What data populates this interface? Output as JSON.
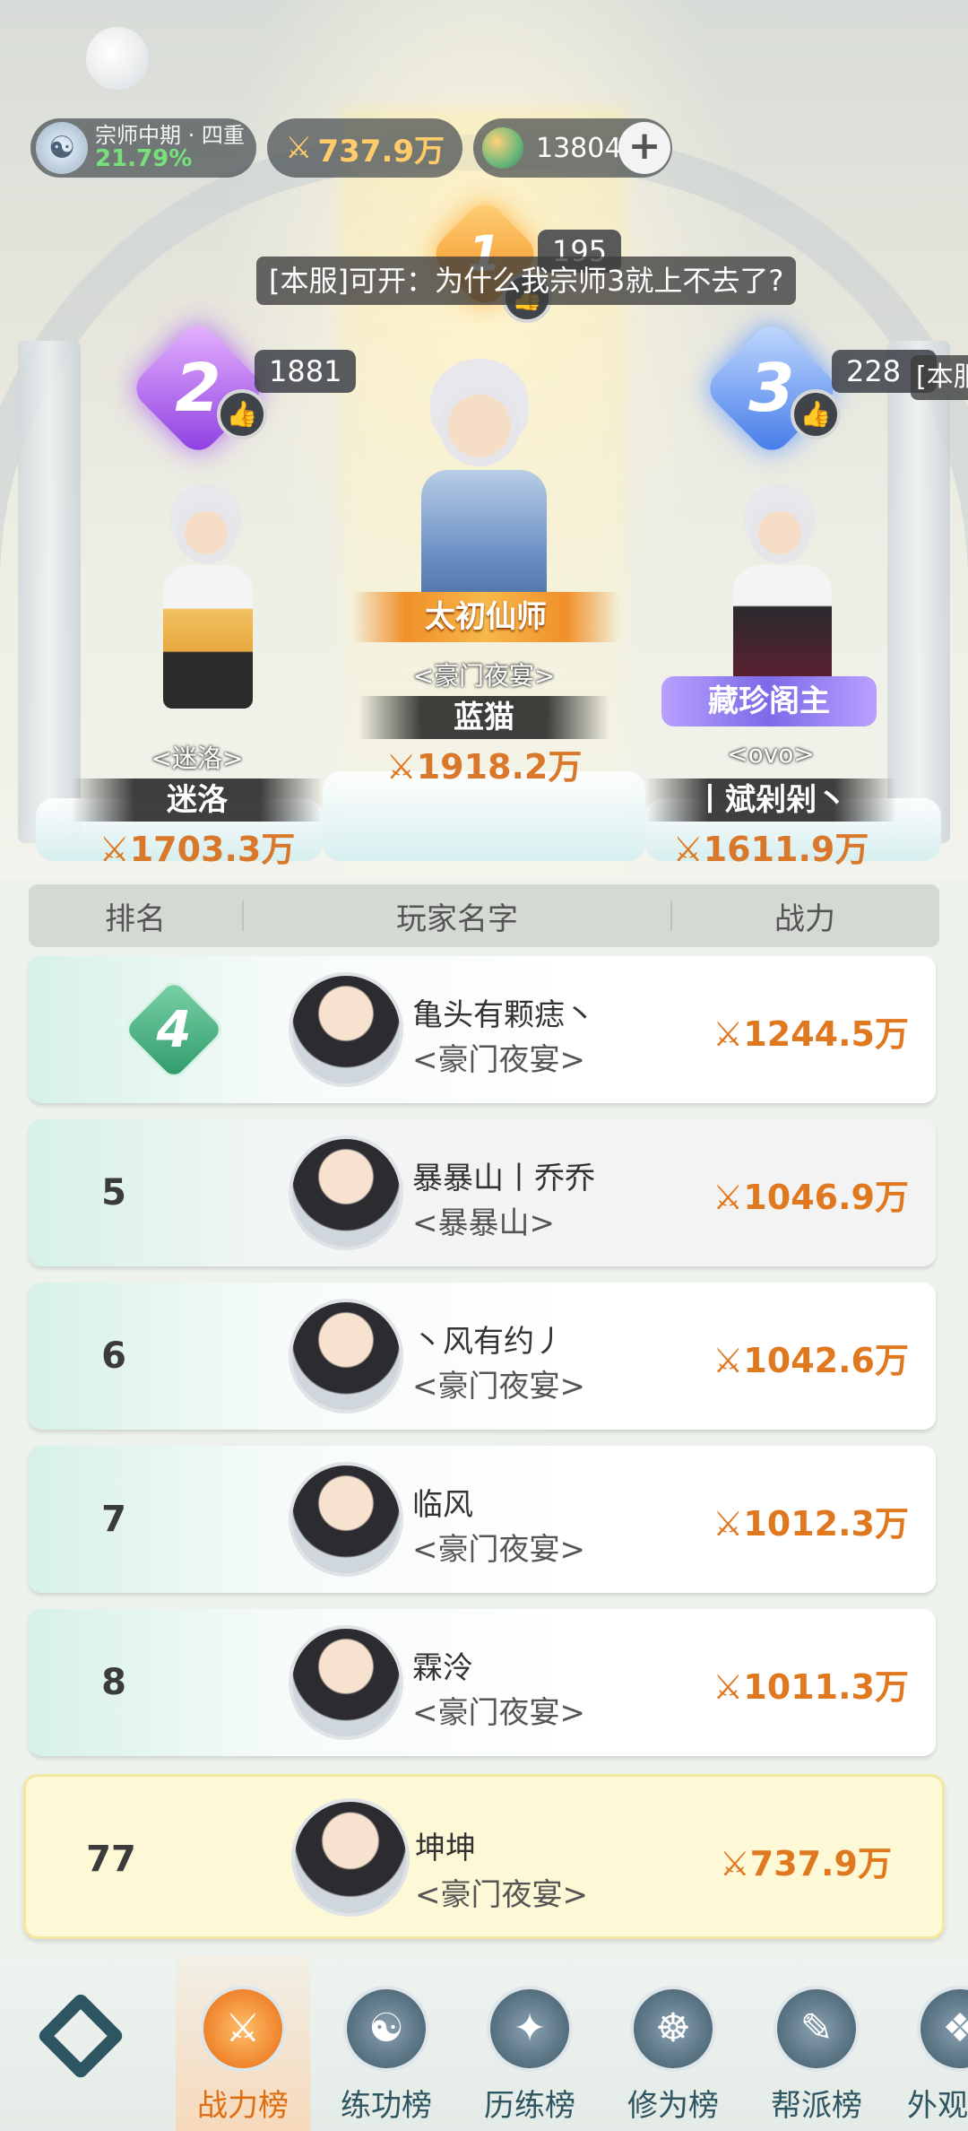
{
  "status_bar": {
    "realm_name": "宗师中期 · 四重",
    "realm_progress": "21.79%",
    "power": "737.9万",
    "jade": "13804",
    "add_label": "+"
  },
  "chat": {
    "main": "[本服]可开：为什么我宗师3就上不去了?",
    "edge": "[本服"
  },
  "podium": {
    "first": {
      "rank": "1",
      "likes": "195",
      "title": "太初仙师",
      "guild": "<豪门夜宴>",
      "name": "蓝猫",
      "power": "1918.2万"
    },
    "second": {
      "rank": "2",
      "likes": "1881",
      "guild": "<迷洛>",
      "name": "迷洛",
      "power": "1703.3万"
    },
    "third": {
      "rank": "3",
      "likes": "228",
      "title": "藏珍阁主",
      "guild": "<ovo>",
      "name": "丨斌剁剁丶",
      "power": "1611.9万"
    }
  },
  "table": {
    "headers": [
      "排名",
      "玩家名字",
      "战力"
    ],
    "rows": [
      {
        "rank": "4",
        "name": "亀头有颗痣丶",
        "guild": "<豪门夜宴>",
        "power": "1244.5万"
      },
      {
        "rank": "5",
        "name": "暴暴山丨乔乔",
        "guild": "<暴暴山>",
        "power": "1046.9万"
      },
      {
        "rank": "6",
        "name": "丶风有约丿",
        "guild": "<豪门夜宴>",
        "power": "1042.6万"
      },
      {
        "rank": "7",
        "name": "临风",
        "guild": "<豪门夜宴>",
        "power": "1012.3万"
      },
      {
        "rank": "8",
        "name": "霖泠",
        "guild": "<豪门夜宴>",
        "power": "1011.3万"
      }
    ],
    "self": {
      "rank": "77",
      "name": "坤坤",
      "guild": "<豪门夜宴>",
      "power": "737.9万"
    }
  },
  "nav": {
    "tabs": [
      "战力榜",
      "练功榜",
      "历练榜",
      "修为榜",
      "帮派榜",
      "外观"
    ],
    "active": 0
  },
  "colors": {
    "power_orange": "#e07820",
    "nav_dark": "#2e5562",
    "active_orange": "#e06d10",
    "progress_green": "#77e07b"
  }
}
